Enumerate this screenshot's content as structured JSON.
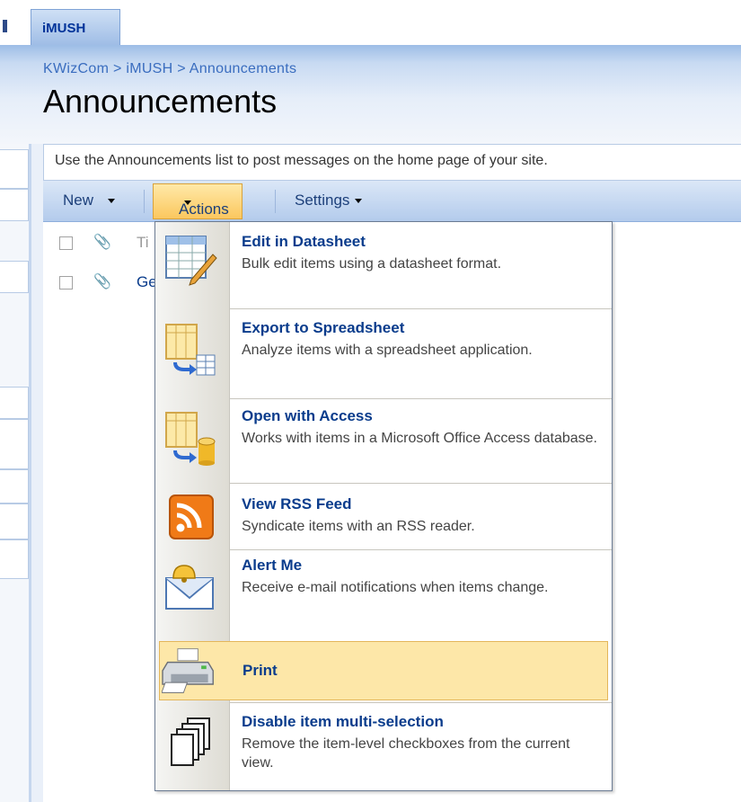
{
  "site_tab": {
    "label": "iMUSH"
  },
  "breadcrumb": "KWizCom > iMUSH > Announcements",
  "page_title": "Announcements",
  "description": "Use the Announcements list to post messages on the home page of your site.",
  "toolbar": {
    "new_label": "New",
    "actions_label": "Actions",
    "settings_label": "Settings"
  },
  "list": {
    "header_title": "Ti",
    "first_row_title": "Ge"
  },
  "actions_menu": {
    "items": [
      {
        "title": "Edit in Datasheet",
        "desc": "Bulk edit items using a datasheet format.",
        "icon": "datasheet-icon"
      },
      {
        "title": "Export to Spreadsheet",
        "desc": "Analyze items with a spreadsheet application.",
        "icon": "spreadsheet-icon"
      },
      {
        "title": "Open with Access",
        "desc": "Works with items in a Microsoft Office Access database.",
        "icon": "access-icon"
      },
      {
        "title": "View RSS Feed",
        "desc": "Syndicate items with an RSS reader.",
        "icon": "rss-icon"
      },
      {
        "title": "Alert Me",
        "desc": "Receive e-mail notifications when items change.",
        "icon": "alert-icon"
      },
      {
        "title": "Print",
        "desc": "",
        "icon": "printer-icon"
      },
      {
        "title": "Disable item multi-selection",
        "desc": "Remove the item-level checkboxes from the current view.",
        "icon": "pages-icon"
      }
    ]
  },
  "colors": {
    "accent": "#0a3c8c",
    "highlight": "#fde7a8"
  }
}
